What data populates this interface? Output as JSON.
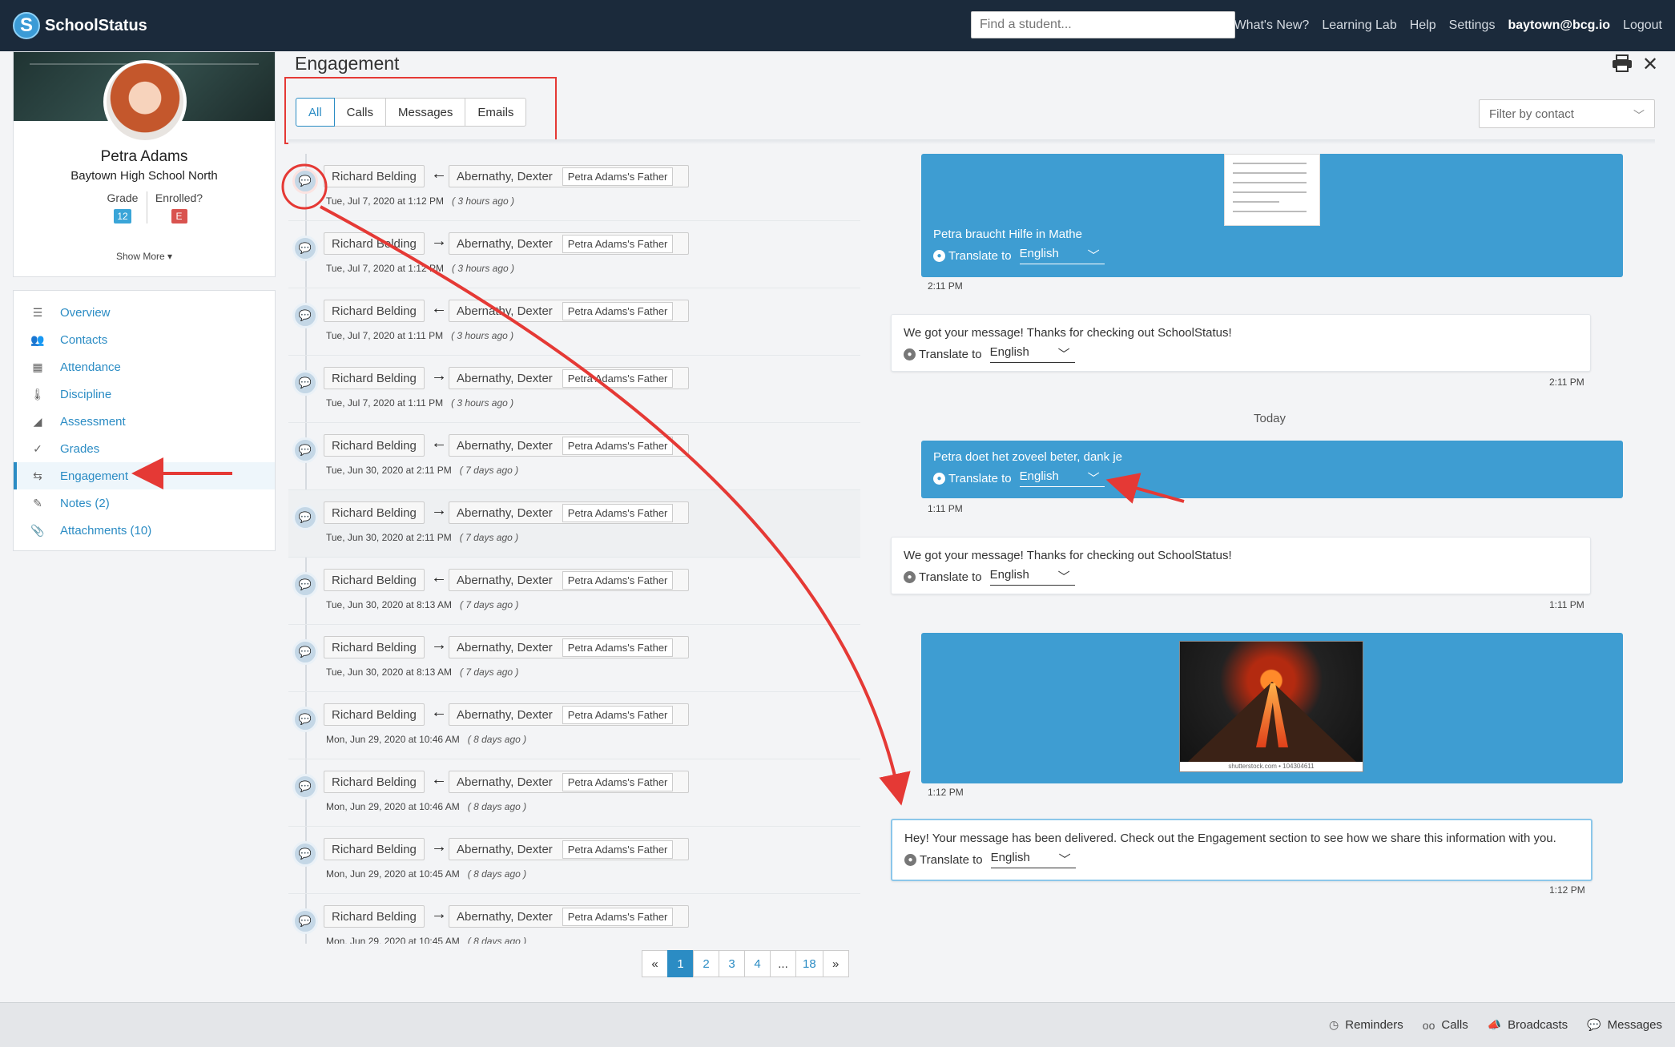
{
  "app": {
    "name": "SchoolStatus",
    "logo_letter": "S"
  },
  "search": {
    "placeholder": "Find a student..."
  },
  "nav": {
    "whats_new": "What's New?",
    "learning_lab": "Learning Lab",
    "help": "Help",
    "settings": "Settings",
    "user": "baytown@bcg.io",
    "logout": "Logout"
  },
  "student": {
    "name": "Petra Adams",
    "school": "Baytown High School North",
    "grade_label": "Grade",
    "grade": "12",
    "enrolled_label": "Enrolled?",
    "enrolled": "E",
    "show_more": "Show More ▾"
  },
  "menu": {
    "items": [
      {
        "label": "Overview",
        "icon": "list-icon"
      },
      {
        "label": "Contacts",
        "icon": "users-icon"
      },
      {
        "label": "Attendance",
        "icon": "calendar-icon"
      },
      {
        "label": "Discipline",
        "icon": "thermometer-icon"
      },
      {
        "label": "Assessment",
        "icon": "chart-icon"
      },
      {
        "label": "Grades",
        "icon": "check-icon"
      },
      {
        "label": "Engagement",
        "icon": "exchange-icon",
        "active": true
      },
      {
        "label": "Notes (2)",
        "icon": "pencil-icon"
      },
      {
        "label": "Attachments (10)",
        "icon": "paperclip-icon"
      }
    ]
  },
  "main": {
    "title": "Engagement",
    "tabs": [
      "All",
      "Calls",
      "Messages",
      "Emails"
    ],
    "active_tab": "All",
    "filter_placeholder": "Filter by contact"
  },
  "engagements": [
    {
      "from": "Richard Belding",
      "direction": "←",
      "contact": "Abernathy, Dexter",
      "role": "Petra Adams's Father",
      "time": "Tue, Jul 7, 2020 at 1:12 PM",
      "ago": "( 3 hours ago )"
    },
    {
      "from": "Richard Belding",
      "direction": "→",
      "contact": "Abernathy, Dexter",
      "role": "Petra Adams's Father",
      "time": "Tue, Jul 7, 2020 at 1:12 PM",
      "ago": "( 3 hours ago )"
    },
    {
      "from": "Richard Belding",
      "direction": "←",
      "contact": "Abernathy, Dexter",
      "role": "Petra Adams's Father",
      "time": "Tue, Jul 7, 2020 at 1:11 PM",
      "ago": "( 3 hours ago )"
    },
    {
      "from": "Richard Belding",
      "direction": "→",
      "contact": "Abernathy, Dexter",
      "role": "Petra Adams's Father",
      "time": "Tue, Jul 7, 2020 at 1:11 PM",
      "ago": "( 3 hours ago )"
    },
    {
      "from": "Richard Belding",
      "direction": "←",
      "contact": "Abernathy, Dexter",
      "role": "Petra Adams's Father",
      "time": "Tue, Jun 30, 2020 at 2:11 PM",
      "ago": "( 7 days ago )"
    },
    {
      "from": "Richard Belding",
      "direction": "→",
      "contact": "Abernathy, Dexter",
      "role": "Petra Adams's Father",
      "time": "Tue, Jun 30, 2020 at 2:11 PM",
      "ago": "( 7 days ago )"
    },
    {
      "from": "Richard Belding",
      "direction": "←",
      "contact": "Abernathy, Dexter",
      "role": "Petra Adams's Father",
      "time": "Tue, Jun 30, 2020 at 8:13 AM",
      "ago": "( 7 days ago )"
    },
    {
      "from": "Richard Belding",
      "direction": "→",
      "contact": "Abernathy, Dexter",
      "role": "Petra Adams's Father",
      "time": "Tue, Jun 30, 2020 at 8:13 AM",
      "ago": "( 7 days ago )"
    },
    {
      "from": "Richard Belding",
      "direction": "←",
      "contact": "Abernathy, Dexter",
      "role": "Petra Adams's Father",
      "time": "Mon, Jun 29, 2020 at 10:46 AM",
      "ago": "( 8 days ago )"
    },
    {
      "from": "Richard Belding",
      "direction": "←",
      "contact": "Abernathy, Dexter",
      "role": "Petra Adams's Father",
      "time": "Mon, Jun 29, 2020 at 10:46 AM",
      "ago": "( 8 days ago )"
    },
    {
      "from": "Richard Belding",
      "direction": "→",
      "contact": "Abernathy, Dexter",
      "role": "Petra Adams's Father",
      "time": "Mon, Jun 29, 2020 at 10:45 AM",
      "ago": "( 8 days ago )"
    },
    {
      "from": "Richard Belding",
      "direction": "→",
      "contact": "Abernathy, Dexter",
      "role": "Petra Adams's Father",
      "time": "Mon, Jun 29, 2020 at 10:45 AM",
      "ago": "( 8 days ago )"
    }
  ],
  "conversation": {
    "translate_label": "Translate to",
    "language": "English",
    "day_separator": "Today",
    "messages": [
      {
        "text": "Petra braucht Hilfe in Mathe",
        "time": "2:11 PM"
      },
      {
        "text": "We got your message! Thanks for checking out SchoolStatus!",
        "time": "2:11 PM"
      },
      {
        "text": "Petra doet het zoveel beter, dank je",
        "time": "1:11 PM"
      },
      {
        "text": "We got your message! Thanks for checking out SchoolStatus!",
        "time": "1:11 PM"
      },
      {
        "text": "",
        "time": "1:12 PM",
        "image_caption": "shutterstock.com • 104304611"
      },
      {
        "text": "Hey! Your message has been delivered. Check out the Engagement section to see how we share this information with you.",
        "time": "1:12 PM"
      }
    ]
  },
  "pagination": {
    "prev": "«",
    "pages": [
      "1",
      "2",
      "3",
      "4",
      "...",
      "18"
    ],
    "current": "1",
    "next": "»"
  },
  "bottombar": {
    "reminders": "Reminders",
    "calls": "Calls",
    "broadcasts": "Broadcasts",
    "messages": "Messages"
  },
  "colors": {
    "nav_bg": "#1b2a3b",
    "accent": "#2b8cc4",
    "outgoing_bubble": "#3e9dd2",
    "annotation": "#e53935"
  }
}
